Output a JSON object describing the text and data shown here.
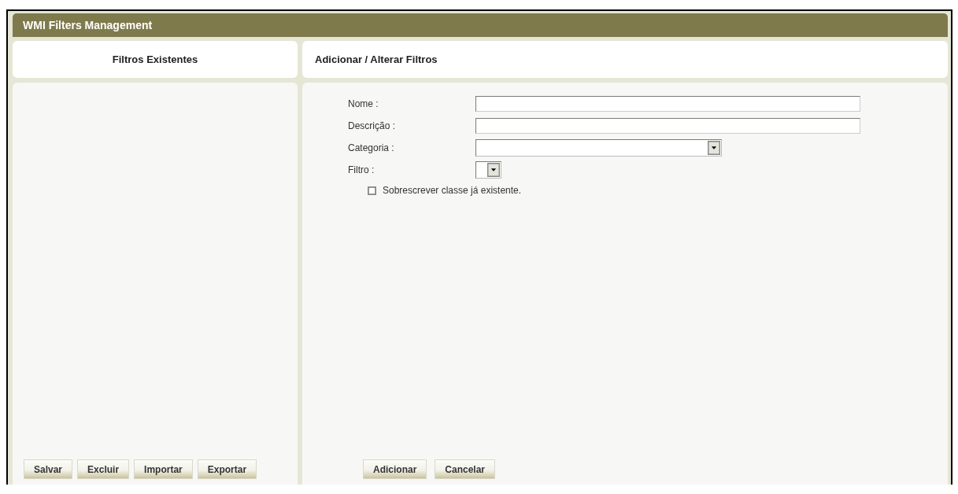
{
  "window": {
    "title": "WMI Filters Management"
  },
  "left_panel": {
    "heading": "Filtros Existentes",
    "buttons": [
      "Salvar",
      "Excluir",
      "Importar",
      "Exportar"
    ]
  },
  "right_panel": {
    "heading": "Adicionar / Alterar Filtros",
    "fields": [
      {
        "label": "Nome :",
        "kind": "text"
      },
      {
        "label": "Descrição :",
        "kind": "text"
      },
      {
        "label": "Categoria :",
        "kind": "select"
      },
      {
        "label": "Filtro :",
        "kind": "select-small"
      }
    ],
    "overwrite": {
      "label": "Sobrescrever classe já existente.",
      "checked": false
    },
    "buttons": [
      "Adicionar",
      "Cancelar"
    ]
  }
}
